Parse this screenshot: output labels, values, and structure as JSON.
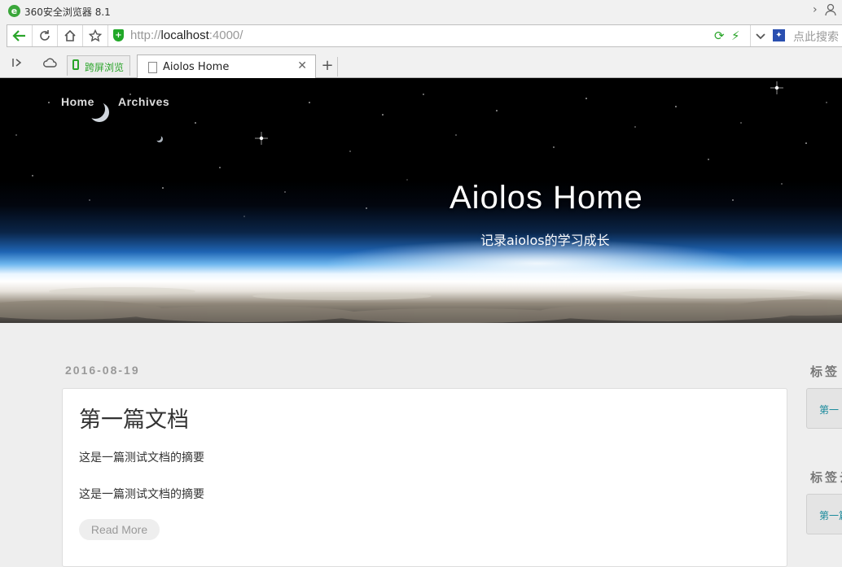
{
  "browser": {
    "app_title": "360安全浏览器 8.1",
    "url_scheme": "http://",
    "url_host": "localhost",
    "url_port_path": ":4000/",
    "search_placeholder": "点此搜索",
    "tabs": [
      {
        "label": "跨屏浏览",
        "icon": "phone-icon"
      },
      {
        "label": "Aiolos Home",
        "icon": "document-icon",
        "active": true
      }
    ],
    "accent_color": "#2aa52a"
  },
  "site": {
    "nav": [
      "Home",
      "Archives"
    ],
    "title": "Aiolos Home",
    "subtitle": "记录aiolos的学习成长"
  },
  "post": {
    "date": "2016-08-19",
    "title": "第一篇文档",
    "excerpt_1": "这是一篇测试文档的摘要",
    "excerpt_2": "这是一篇测试文档的摘要",
    "read_more": "Read More"
  },
  "sidebar": {
    "tags_heading": "标签",
    "tags_link": "第一",
    "tag_cloud_heading": "标签云",
    "tag_cloud_link": "第一篇"
  }
}
